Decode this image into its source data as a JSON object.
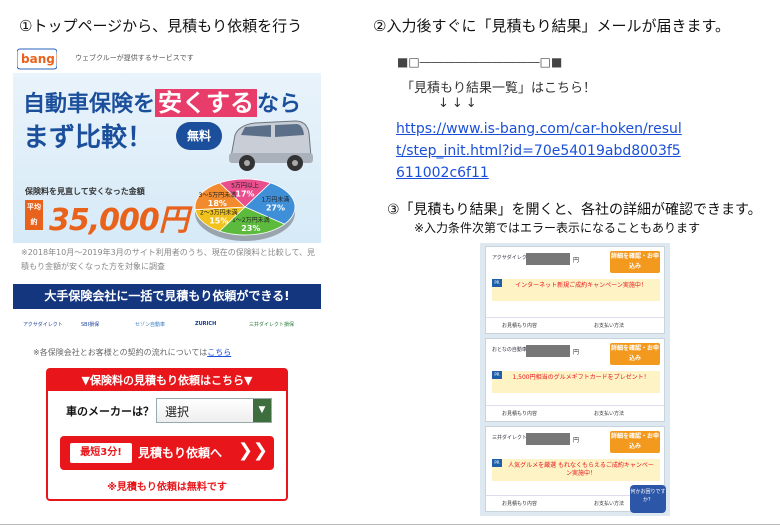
{
  "steps": {
    "step1": "①トップページから、見積もり依頼を行う",
    "step2": "②入力後すぐに「見積もり結果」メールが届きます。",
    "step3": "③「見積もり結果」を開くと、各社の詳細が確認できます。",
    "step3_note": "※入力条件次第ではエラー表示になることもあります"
  },
  "phone1": {
    "logo_text": "bang!",
    "tagline": "ウェブクルーが提供するサービスです",
    "hero_prefix": "自動車保険を",
    "hero_highlight": "安くする",
    "hero_suffix": "なら",
    "hero_line2": "まず比較！",
    "free_badge": "無料",
    "saving_caption": "保険料を見直して安くなった金額",
    "avg_label": "平均約",
    "big_amount": "35,000円",
    "pie": [
      {
        "label": "5万円以上",
        "pct": "17%",
        "value": 17,
        "color": "#e84f8c"
      },
      {
        "label": "1万円未満",
        "pct": "27%",
        "value": 27,
        "color": "#3e8fd8"
      },
      {
        "label": "1〜2万円未満",
        "pct": "23%",
        "value": 23,
        "color": "#5cba3c"
      },
      {
        "label": "2〜3万円未満",
        "pct": "15%",
        "value": 15,
        "color": "#f2c21c"
      },
      {
        "label": "3〜5万円未満",
        "pct": "18%",
        "value": 18,
        "color": "#f28a2e"
      }
    ],
    "note": "※2018年10月〜2019年3月のサイト利用者のうち、現在の保険料と比較して、見積もり金額が安くなった方を対象に調査",
    "banner": "大手保険会社に一括で見積もり依頼ができる!",
    "insurers": [
      "アクサダイレクト",
      "SBI損保",
      "セゾン自動車",
      "ZURICH",
      "三井ダイレクト損保"
    ],
    "contract_note": "※各保険会社とお客様との契約の流れについては",
    "contract_link": "こちら",
    "cta_header": "▼保険料の見積もり依頼はこちら▼",
    "maker_label": "車のメーカーは？",
    "maker_select": "選択",
    "short_badge": "最短3分!",
    "request_label": "見積もり依頼へ",
    "request_arrow": "❯❯",
    "free_note": "※見積もり依頼は無料です"
  },
  "email": {
    "decoration": "■□――――――――――□■",
    "list_text": "「見積もり結果一覧」はこちら！",
    "arrows": "↓↓↓",
    "url": "https://www.is-bang.com/car-hoken/result/step_init.html?id=70e54019abd8003f5611002c6f11"
  },
  "phone2": {
    "cards": [
      {
        "company": "アクサダイレクト",
        "yen": "円",
        "button": "詳細を確認・お申込み",
        "promo": "インターネット新規ご成約キャンペーン実施中！",
        "link1": "お見積もり内容",
        "link2": "お支払い方法"
      },
      {
        "company": "おとなの自動車保険",
        "yen": "円",
        "button": "詳細を確認・お申込み",
        "promo": "1,500円相当のグルメギフトカードをプレゼント！",
        "link1": "お見積もり内容",
        "link2": "お支払い方法"
      },
      {
        "company": "三井ダイレクト損保",
        "yen": "円",
        "button": "詳細を確認・お申込み",
        "promo": "人気グルメを厳選 もれなくもらえるご成約キャンペーン実施中！",
        "link1": "お見積もり内容",
        "link2": "お支払い方法"
      }
    ],
    "chat": "何かお困りですか？"
  }
}
